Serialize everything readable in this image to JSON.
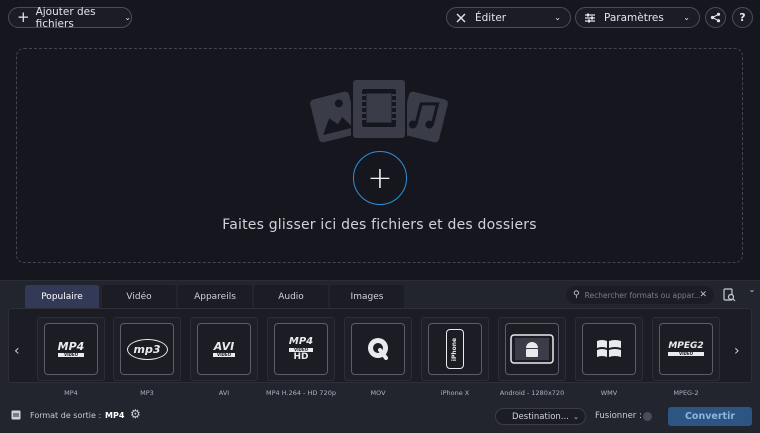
{
  "toolbar": {
    "add_files_label": "Ajouter des fichiers",
    "edit_label": "Éditer",
    "settings_label": "Paramètres",
    "help_label": "?"
  },
  "dropzone": {
    "text": "Faites glisser ici des fichiers et des dossiers"
  },
  "tabs": [
    {
      "label": "Populaire",
      "active": true
    },
    {
      "label": "Vidéo",
      "active": false
    },
    {
      "label": "Appareils",
      "active": false
    },
    {
      "label": "Audio",
      "active": false
    },
    {
      "label": "Images",
      "active": false
    }
  ],
  "search": {
    "placeholder": "Rechercher formats ou appar..."
  },
  "formats": [
    {
      "label": "MP4",
      "icon": "mp4-icon"
    },
    {
      "label": "MP3",
      "icon": "mp3-icon"
    },
    {
      "label": "AVI",
      "icon": "avi-icon"
    },
    {
      "label": "MP4 H.264 - HD 720p",
      "icon": "mp4-hd-icon"
    },
    {
      "label": "MOV",
      "icon": "quicktime-icon"
    },
    {
      "label": "iPhone X",
      "icon": "iphone-icon"
    },
    {
      "label": "Android - 1280x720",
      "icon": "android-icon"
    },
    {
      "label": "WMV",
      "icon": "windows-icon"
    },
    {
      "label": "MPEG-2",
      "icon": "mpeg2-icon"
    }
  ],
  "card_text": {
    "mp4": "MP4",
    "mp4_sub": "VIDEO",
    "mp3": "mp3",
    "avi": "AVI",
    "avi_sub": "VIDEO",
    "mp4hd": "MP4",
    "mp4hd_sub": "VIDEO",
    "mp4hd_hd": "HD",
    "iphone": "iPhone",
    "mpeg2": "MPEG2",
    "mpeg2_sub": "VIDEO"
  },
  "footer": {
    "output_format_label": "Format de sortie :",
    "output_format_value": "MP4",
    "destination_label": "Destination...",
    "merge_label": "Fusionner :",
    "convert_label": "Convertir"
  },
  "colors": {
    "accent": "#2e8fd8",
    "active_tab": "#333a58",
    "convert_bg": "#2d5584"
  }
}
